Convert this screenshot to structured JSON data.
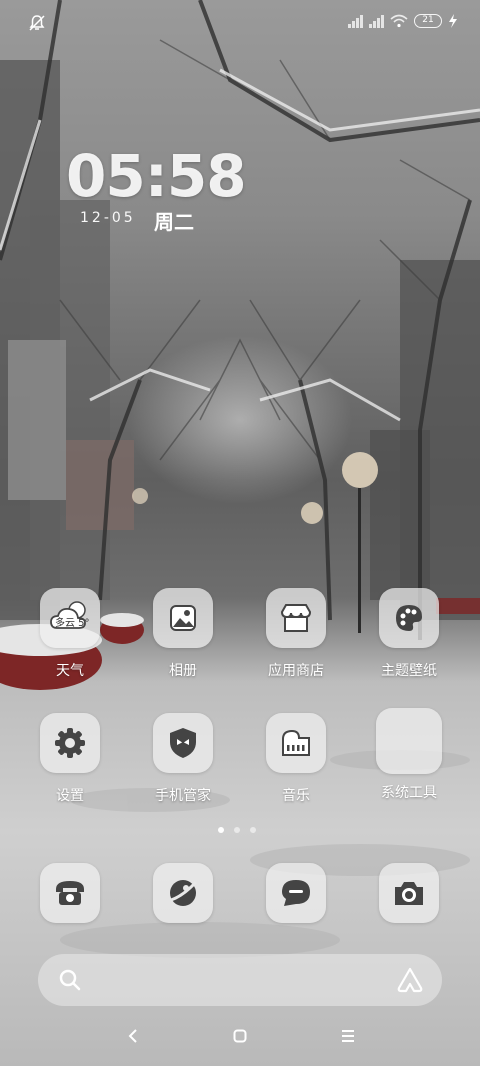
{
  "statusbar": {
    "battery": "21"
  },
  "clock": {
    "time": "05:58",
    "date": "12-05",
    "weekday": "周二"
  },
  "apps": [
    {
      "label": "天气",
      "icon": "weather-cloud-icon",
      "weather_text": "多云 5°"
    },
    {
      "label": "相册",
      "icon": "gallery-icon"
    },
    {
      "label": "应用商店",
      "icon": "app-store-icon"
    },
    {
      "label": "主题壁纸",
      "icon": "palette-icon"
    },
    {
      "label": "设置",
      "icon": "gear-icon"
    },
    {
      "label": "手机管家",
      "icon": "security-shield-icon"
    },
    {
      "label": "音乐",
      "icon": "piano-icon"
    },
    {
      "label": "系统工具",
      "icon": "folder-grid-icon"
    }
  ],
  "pager": {
    "pages": 3,
    "active": 1
  },
  "dock": [
    {
      "icon": "phone-icon"
    },
    {
      "icon": "browser-icon"
    },
    {
      "icon": "messages-icon"
    },
    {
      "icon": "camera-icon"
    }
  ],
  "search": {
    "icon": "search-icon",
    "assistant_icon": "assistant-icon"
  },
  "navbar": [
    "back-icon",
    "home-icon",
    "menu-icon"
  ]
}
